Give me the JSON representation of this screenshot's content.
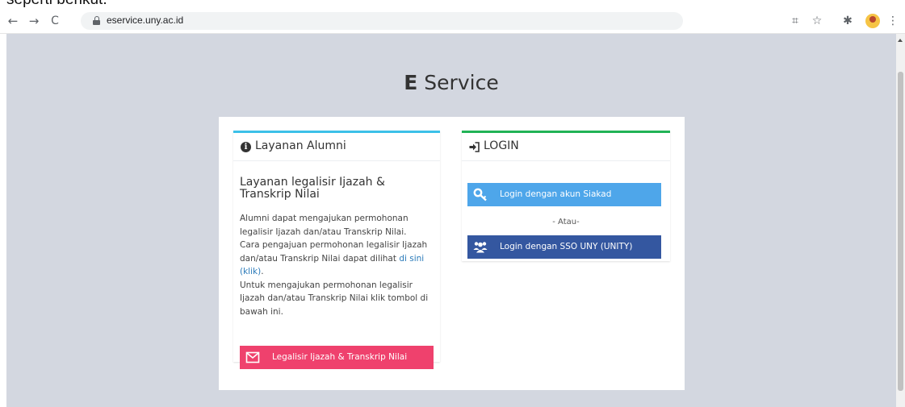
{
  "caption": {
    "text": "seperti berikut."
  },
  "browser": {
    "back_glyph": "←",
    "forward_glyph": "→",
    "reload_glyph": "C",
    "url": "eservice.uny.ac.id",
    "qr_glyph": "⌗",
    "star_glyph": "☆",
    "extensions_glyph": "✱",
    "menu_glyph": "⋮"
  },
  "page": {
    "title_bold": "E",
    "title_rest": " Service"
  },
  "alumni_card": {
    "header": "Layanan Alumni",
    "heading": "Layanan legalisir Ijazah & Transkrip Nilai",
    "body_1": "Alumni dapat mengajukan permohonan legalisir Ijazah dan/atau Transkrip Nilai.",
    "body_2": "Cara pengajuan permohonan legalisir Ijazah dan/atau Transkrip Nilai dapat dilihat ",
    "link": "di sini (klik)",
    "body_2_end": ".",
    "body_3": "Untuk mengajukan permohonan legalisir Ijazah dan/atau Transkrip Nilai klik tombol di bawah ini.",
    "button": "Legalisir Ijazah & Transkrip Nilai"
  },
  "login_card": {
    "header": "LOGIN",
    "siakad_button": "Login dengan akun Siakad",
    "separator": "- Atau-",
    "sso_button": "Login dengan SSO UNY (UNITY)"
  },
  "colors": {
    "alumni_accent": "#3bc0e8",
    "login_accent": "#21b356",
    "legalisir_button": "#ef416d",
    "siakad_button": "#4ea6ea",
    "sso_button": "#3457a0",
    "page_background": "#d3d7e0",
    "link": "#2a7ab9"
  },
  "icons": {
    "alumni_header": "info-circle-icon",
    "login_header": "sign-in-icon",
    "legalisir_button": "envelope-icon",
    "siakad_button": "key-icon",
    "sso_button": "users-icon"
  }
}
